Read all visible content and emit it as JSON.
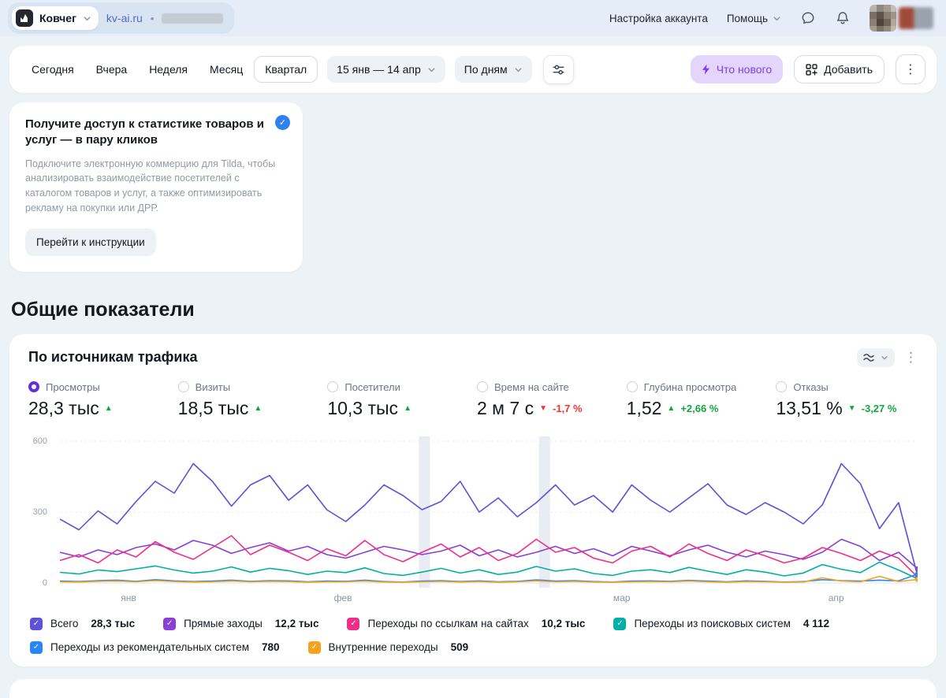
{
  "header": {
    "counter_name": "Ковчег",
    "site_link": "kv-ai.ru",
    "separator": "•",
    "account_settings_label": "Настройка аккаунта",
    "help_label": "Помощь"
  },
  "toolbar": {
    "periods": [
      "Сегодня",
      "Вчера",
      "Неделя",
      "Месяц",
      "Квартал"
    ],
    "active_period": "Квартал",
    "date_range": "15 янв — 14 апр",
    "granularity": "По дням",
    "whats_new_label": "Что нового",
    "add_label": "Добавить"
  },
  "promo": {
    "title": "Получите доступ к статистике товаров и услуг — в пару кликов",
    "body": "Подключите электронную коммерцию для Tilda, чтобы анализировать взаимодействие посетителей с каталогом товаров и услуг, а также оптимизировать рекламу на покупки или ДРР.",
    "button_label": "Перейти к инструкции"
  },
  "section_title": "Общие показатели",
  "widget": {
    "title": "По источникам трафика",
    "metrics": [
      {
        "label": "Просмотры",
        "value": "28,3 тыс",
        "trend": "▲",
        "trend_color": "#0fa73c",
        "delta": "",
        "delta_color": "",
        "selected": true
      },
      {
        "label": "Визиты",
        "value": "18,5 тыс",
        "trend": "▲",
        "trend_color": "#0fa73c",
        "delta": "",
        "delta_color": "",
        "selected": false
      },
      {
        "label": "Посетители",
        "value": "10,3 тыс",
        "trend": "▲",
        "trend_color": "#0fa73c",
        "delta": "",
        "delta_color": "",
        "selected": false
      },
      {
        "label": "Время на сайте",
        "value": "2 м 7 с",
        "trend": "▼",
        "trend_color": "#f0362b",
        "delta": "-1,7 %",
        "delta_color": "#f0362b",
        "selected": false
      },
      {
        "label": "Глубина просмотра",
        "value": "1,52",
        "trend": "▲",
        "trend_color": "#0fa73c",
        "delta": "+2,66 %",
        "delta_color": "#0fa73c",
        "selected": false
      },
      {
        "label": "Отказы",
        "value": "13,51 %",
        "trend": "▼",
        "trend_color": "#0fa73c",
        "delta": "-3,27 %",
        "delta_color": "#0fa73c",
        "selected": false
      }
    ]
  },
  "chart_data": {
    "type": "line",
    "title": "По источникам трафика",
    "x_axis": {
      "labels": [
        "янв",
        "фев",
        "мар",
        "апр"
      ],
      "label_positions": [
        0.08,
        0.33,
        0.655,
        0.905
      ]
    },
    "y_axis": {
      "ticks": [
        0,
        300,
        600
      ],
      "range": [
        0,
        600
      ]
    },
    "grid": true,
    "legend_position": "bottom",
    "highlight_bands": [
      {
        "center": 0.425,
        "width": 0.013
      },
      {
        "center": 0.565,
        "width": 0.013
      }
    ],
    "series": [
      {
        "id": "total",
        "name": "Всего",
        "total": "28,3 тыс",
        "color": "#5e53d8",
        "values": [
          270,
          225,
          305,
          250,
          345,
          430,
          380,
          505,
          430,
          325,
          415,
          455,
          350,
          415,
          310,
          260,
          330,
          415,
          370,
          310,
          345,
          430,
          300,
          360,
          280,
          340,
          415,
          330,
          370,
          300,
          415,
          350,
          300,
          360,
          420,
          330,
          290,
          340,
          300,
          250,
          330,
          505,
          420,
          230,
          340,
          30
        ]
      },
      {
        "id": "direct",
        "name": "Прямые заходы",
        "total": "12,2 тыс",
        "color": "#8a3fd6",
        "values": [
          130,
          110,
          140,
          120,
          150,
          165,
          140,
          180,
          160,
          125,
          150,
          170,
          135,
          155,
          120,
          105,
          130,
          155,
          140,
          120,
          135,
          160,
          115,
          140,
          110,
          130,
          155,
          125,
          145,
          115,
          155,
          135,
          115,
          140,
          160,
          130,
          110,
          135,
          120,
          100,
          130,
          185,
          155,
          95,
          130,
          60
        ]
      },
      {
        "id": "site-links",
        "name": "Переходы по ссылкам на сайтах",
        "total": "10,2 тыс",
        "color": "#ef2f8a",
        "values": [
          95,
          120,
          85,
          140,
          110,
          175,
          130,
          100,
          150,
          200,
          120,
          160,
          130,
          95,
          145,
          115,
          180,
          120,
          90,
          130,
          165,
          110,
          150,
          95,
          125,
          185,
          130,
          150,
          105,
          85,
          135,
          155,
          110,
          165,
          125,
          95,
          140,
          115,
          85,
          105,
          150,
          125,
          95,
          135,
          105,
          25
        ]
      },
      {
        "id": "search",
        "name": "Переходы из поисковых систем",
        "total": "4 112",
        "color": "#00b0a6",
        "values": [
          45,
          38,
          55,
          48,
          60,
          72,
          55,
          42,
          50,
          68,
          46,
          62,
          52,
          36,
          50,
          44,
          64,
          40,
          32,
          46,
          62,
          42,
          56,
          36,
          46,
          70,
          50,
          60,
          40,
          32,
          50,
          56,
          44,
          66,
          50,
          36,
          56,
          46,
          30,
          42,
          78,
          58,
          44,
          88,
          55,
          18
        ]
      },
      {
        "id": "recommend",
        "name": "Переходы из рекомендательных систем",
        "total": "780",
        "color": "#2787f5",
        "values": [
          8,
          6,
          10,
          12,
          7,
          14,
          9,
          6,
          8,
          12,
          7,
          10,
          9,
          5,
          8,
          7,
          12,
          6,
          4,
          8,
          10,
          6,
          9,
          5,
          7,
          13,
          8,
          10,
          6,
          4,
          8,
          9,
          7,
          11,
          8,
          5,
          9,
          7,
          4,
          6,
          14,
          10,
          8,
          12,
          9,
          38
        ]
      },
      {
        "id": "internal",
        "name": "Внутренние переходы",
        "total": "509",
        "color": "#f6a21e",
        "values": [
          5,
          4,
          7,
          8,
          5,
          10,
          6,
          4,
          5,
          8,
          5,
          7,
          6,
          3,
          5,
          5,
          8,
          4,
          3,
          5,
          7,
          4,
          6,
          3,
          5,
          9,
          5,
          7,
          4,
          3,
          5,
          6,
          5,
          8,
          5,
          3,
          6,
          5,
          3,
          4,
          22,
          8,
          5,
          28,
          6,
          15
        ]
      }
    ]
  },
  "icons": {
    "kebab": "⋮",
    "check": "✓",
    "separator_dot": "•"
  },
  "colors": {
    "accent_purple": "#7b3ff2",
    "green": "#0fa73c",
    "red": "#f0362b",
    "selected_radio": "#6430d9"
  }
}
